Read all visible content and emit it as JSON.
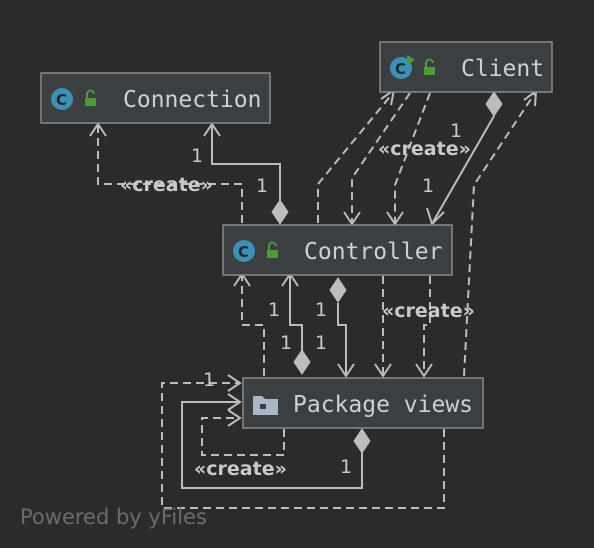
{
  "nodes": {
    "connection": {
      "label": "Connection",
      "icon": "class-c-icon"
    },
    "client": {
      "label": "Client",
      "icon": "runnable-class-c-icon"
    },
    "controller": {
      "label": "Controller",
      "icon": "class-c-icon"
    },
    "package_views": {
      "label": "Package views",
      "icon": "folder-icon"
    }
  },
  "edge_labels": {
    "create": "«create»",
    "one": "1"
  },
  "footer": "Powered by yFiles",
  "colors": {
    "background": "#2b2b2b",
    "node_fill": "#3c3f41",
    "class_icon": "#3d8fb4",
    "unlock_icon": "#4e9a37"
  }
}
